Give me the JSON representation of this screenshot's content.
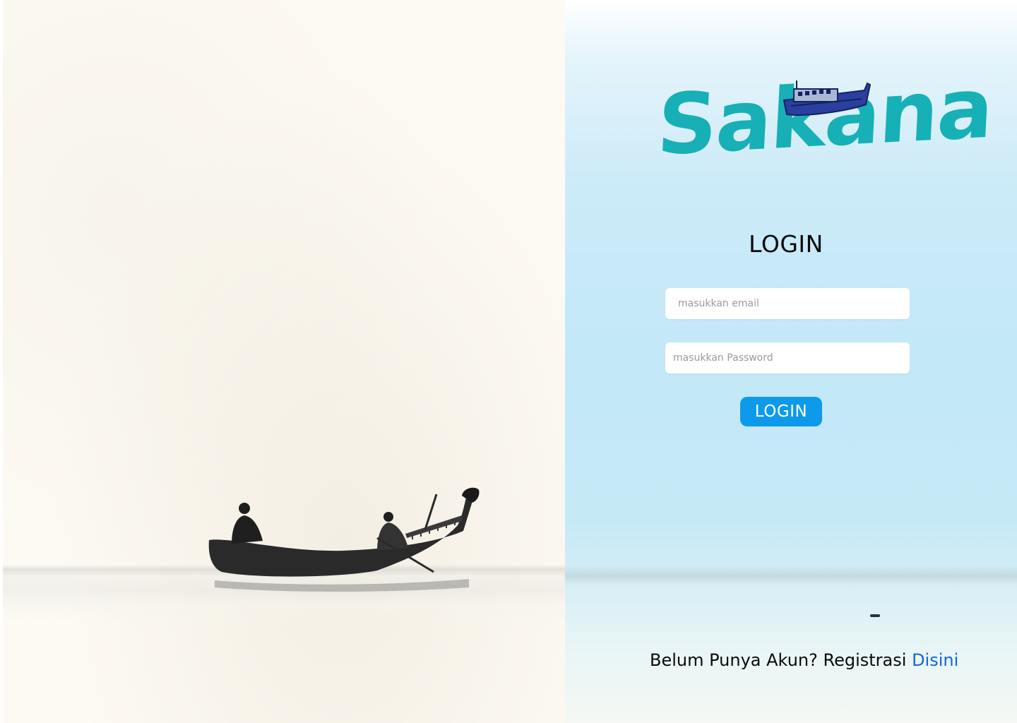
{
  "brand": {
    "logo_text": "Sakana"
  },
  "login": {
    "title": "LOGIN",
    "email_placeholder": "masukkan email",
    "password_placeholder": "masukkan Password",
    "submit_label": "LOGIN"
  },
  "footer": {
    "prompt": "Belum Punya Akun? Registrasi ",
    "link_label": "Disini"
  },
  "colors": {
    "brand_teal": "#16b0b6",
    "button_blue": "#0d9aea",
    "link_blue": "#1166dd",
    "panel_sky": "#c2e8f8"
  }
}
